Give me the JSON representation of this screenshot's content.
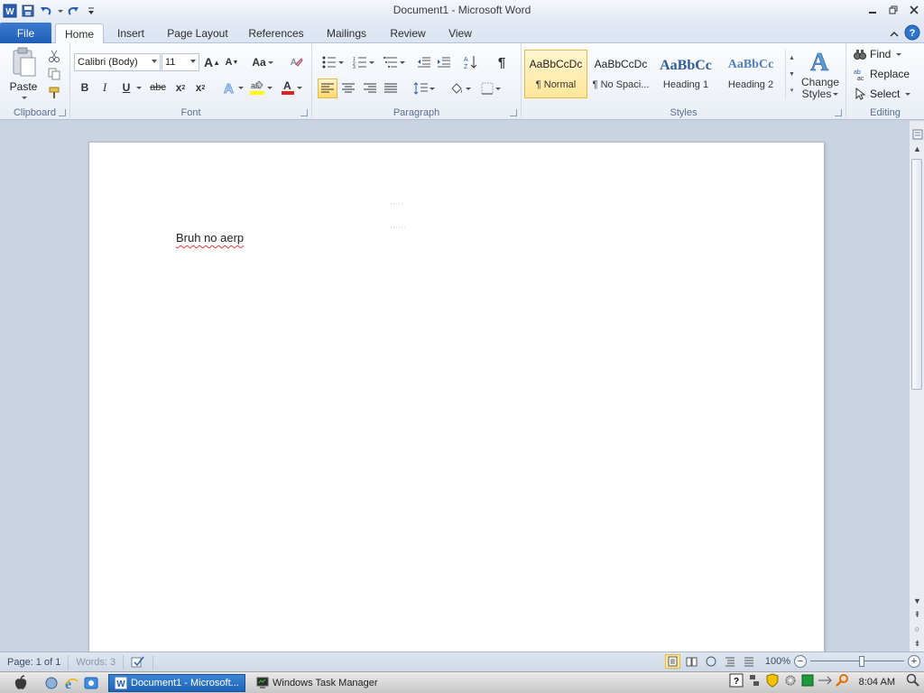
{
  "window": {
    "title": "Document1 - Microsoft Word"
  },
  "tabs": {
    "file": "File",
    "items": [
      "Home",
      "Insert",
      "Page Layout",
      "References",
      "Mailings",
      "Review",
      "View"
    ],
    "active": "Home"
  },
  "ribbon": {
    "clipboard": {
      "label": "Clipboard",
      "paste": "Paste"
    },
    "font": {
      "label": "Font",
      "font_name": "Calibri (Body)",
      "font_size": "11",
      "grow": "A",
      "shrink": "A",
      "change_case": "Aa",
      "bold": "B",
      "italic": "I",
      "underline": "U",
      "strike": "abc",
      "subscript": "x",
      "superscript": "x",
      "font_color_letter": "A"
    },
    "paragraph": {
      "label": "Paragraph",
      "pilcrow": "¶"
    },
    "styles": {
      "label": "Styles",
      "items": [
        {
          "preview": "AaBbCcDc",
          "name": "¶ Normal"
        },
        {
          "preview": "AaBbCcDc",
          "name": "¶ No Spaci..."
        },
        {
          "preview": "AaBbCc",
          "name": "Heading 1"
        },
        {
          "preview": "AaBbCc",
          "name": "Heading 2"
        }
      ],
      "change_styles_line1": "Change",
      "change_styles_line2": "Styles"
    },
    "editing": {
      "label": "Editing",
      "find": "Find",
      "replace": "Replace",
      "select": "Select"
    }
  },
  "document": {
    "text": "Bruh no aerp"
  },
  "statusbar": {
    "page": "Page: 1 of 1",
    "words": "Words: 3",
    "zoom": "100%"
  },
  "taskbar": {
    "buttons": [
      "Document1 - Microsoft...",
      "Windows Task Manager"
    ],
    "clock": "8:04 AM"
  },
  "colors": {
    "accent": "#1f5eb8",
    "selected_style": "#ffe699",
    "spell_error": "#e23a3a"
  }
}
